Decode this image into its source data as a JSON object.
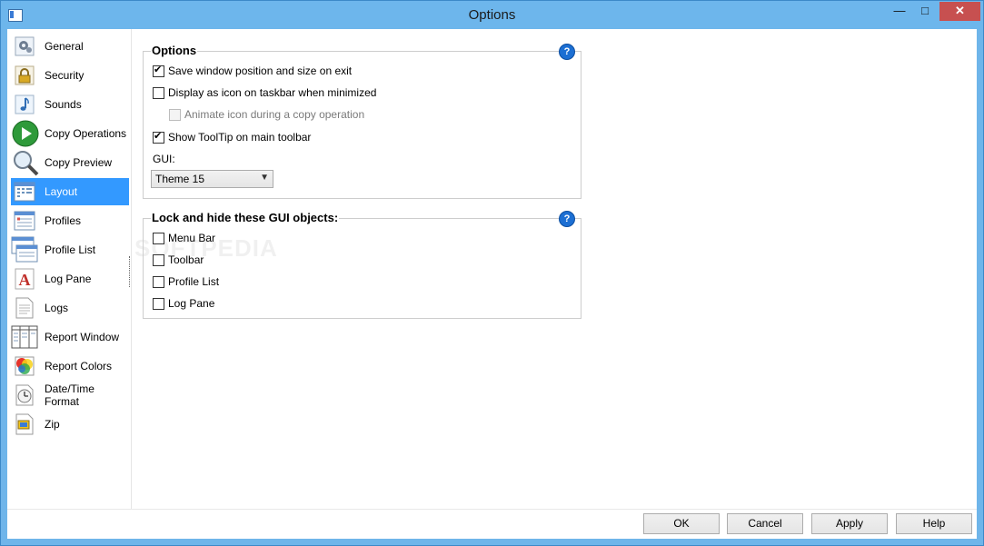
{
  "window": {
    "title": "Options",
    "controls": {
      "minimize": "—",
      "maximize": "□",
      "close": "✕"
    }
  },
  "sidebar": {
    "items": [
      {
        "label": "General",
        "icon": "gear-icon",
        "selected": false
      },
      {
        "label": "Security",
        "icon": "lock-icon",
        "selected": false
      },
      {
        "label": "Sounds",
        "icon": "music-note-icon",
        "selected": false
      },
      {
        "label": "Copy Operations",
        "icon": "play-icon",
        "selected": false
      },
      {
        "label": "Copy Preview",
        "icon": "magnifier-icon",
        "selected": false
      },
      {
        "label": "Layout",
        "icon": "layout-icon",
        "selected": true
      },
      {
        "label": "Profiles",
        "icon": "profiles-icon",
        "selected": false
      },
      {
        "label": "Profile List",
        "icon": "profile-list-icon",
        "selected": false
      },
      {
        "label": "Log Pane",
        "icon": "font-a-icon",
        "selected": false
      },
      {
        "label": "Logs",
        "icon": "document-icon",
        "selected": false
      },
      {
        "label": "Report Window",
        "icon": "report-window-icon",
        "selected": false
      },
      {
        "label": "Report Colors",
        "icon": "color-palette-icon",
        "selected": false
      },
      {
        "label": "Date/Time Format",
        "icon": "clock-icon",
        "selected": false
      },
      {
        "label": "Zip",
        "icon": "zip-icon",
        "selected": false
      }
    ]
  },
  "options": {
    "title": "Options",
    "help": "?",
    "save_window_position": {
      "label": "Save window position and size on exit",
      "checked": true
    },
    "display_as_icon": {
      "label": "Display as icon on taskbar when minimized",
      "checked": false
    },
    "animate_icon": {
      "label": "Animate icon during a copy operation",
      "checked": false,
      "disabled": true
    },
    "show_tooltip": {
      "label": "Show ToolTip on main toolbar",
      "checked": true
    },
    "gui_label": "GUI:",
    "gui_value": "Theme 15"
  },
  "lock": {
    "title": "Lock and hide these GUI objects:",
    "help": "?",
    "items": [
      {
        "label": "Menu Bar",
        "checked": false
      },
      {
        "label": "Toolbar",
        "checked": false
      },
      {
        "label": "Profile List",
        "checked": false
      },
      {
        "label": "Log Pane",
        "checked": false
      }
    ]
  },
  "watermark": "SOFTPEDIA",
  "buttons": {
    "ok": "OK",
    "cancel": "Cancel",
    "apply": "Apply",
    "help": "Help"
  },
  "colors": {
    "titlebar": "#6db6ec",
    "selection": "#3399ff",
    "help_badge": "#1c6fd3",
    "close": "#c75050"
  }
}
